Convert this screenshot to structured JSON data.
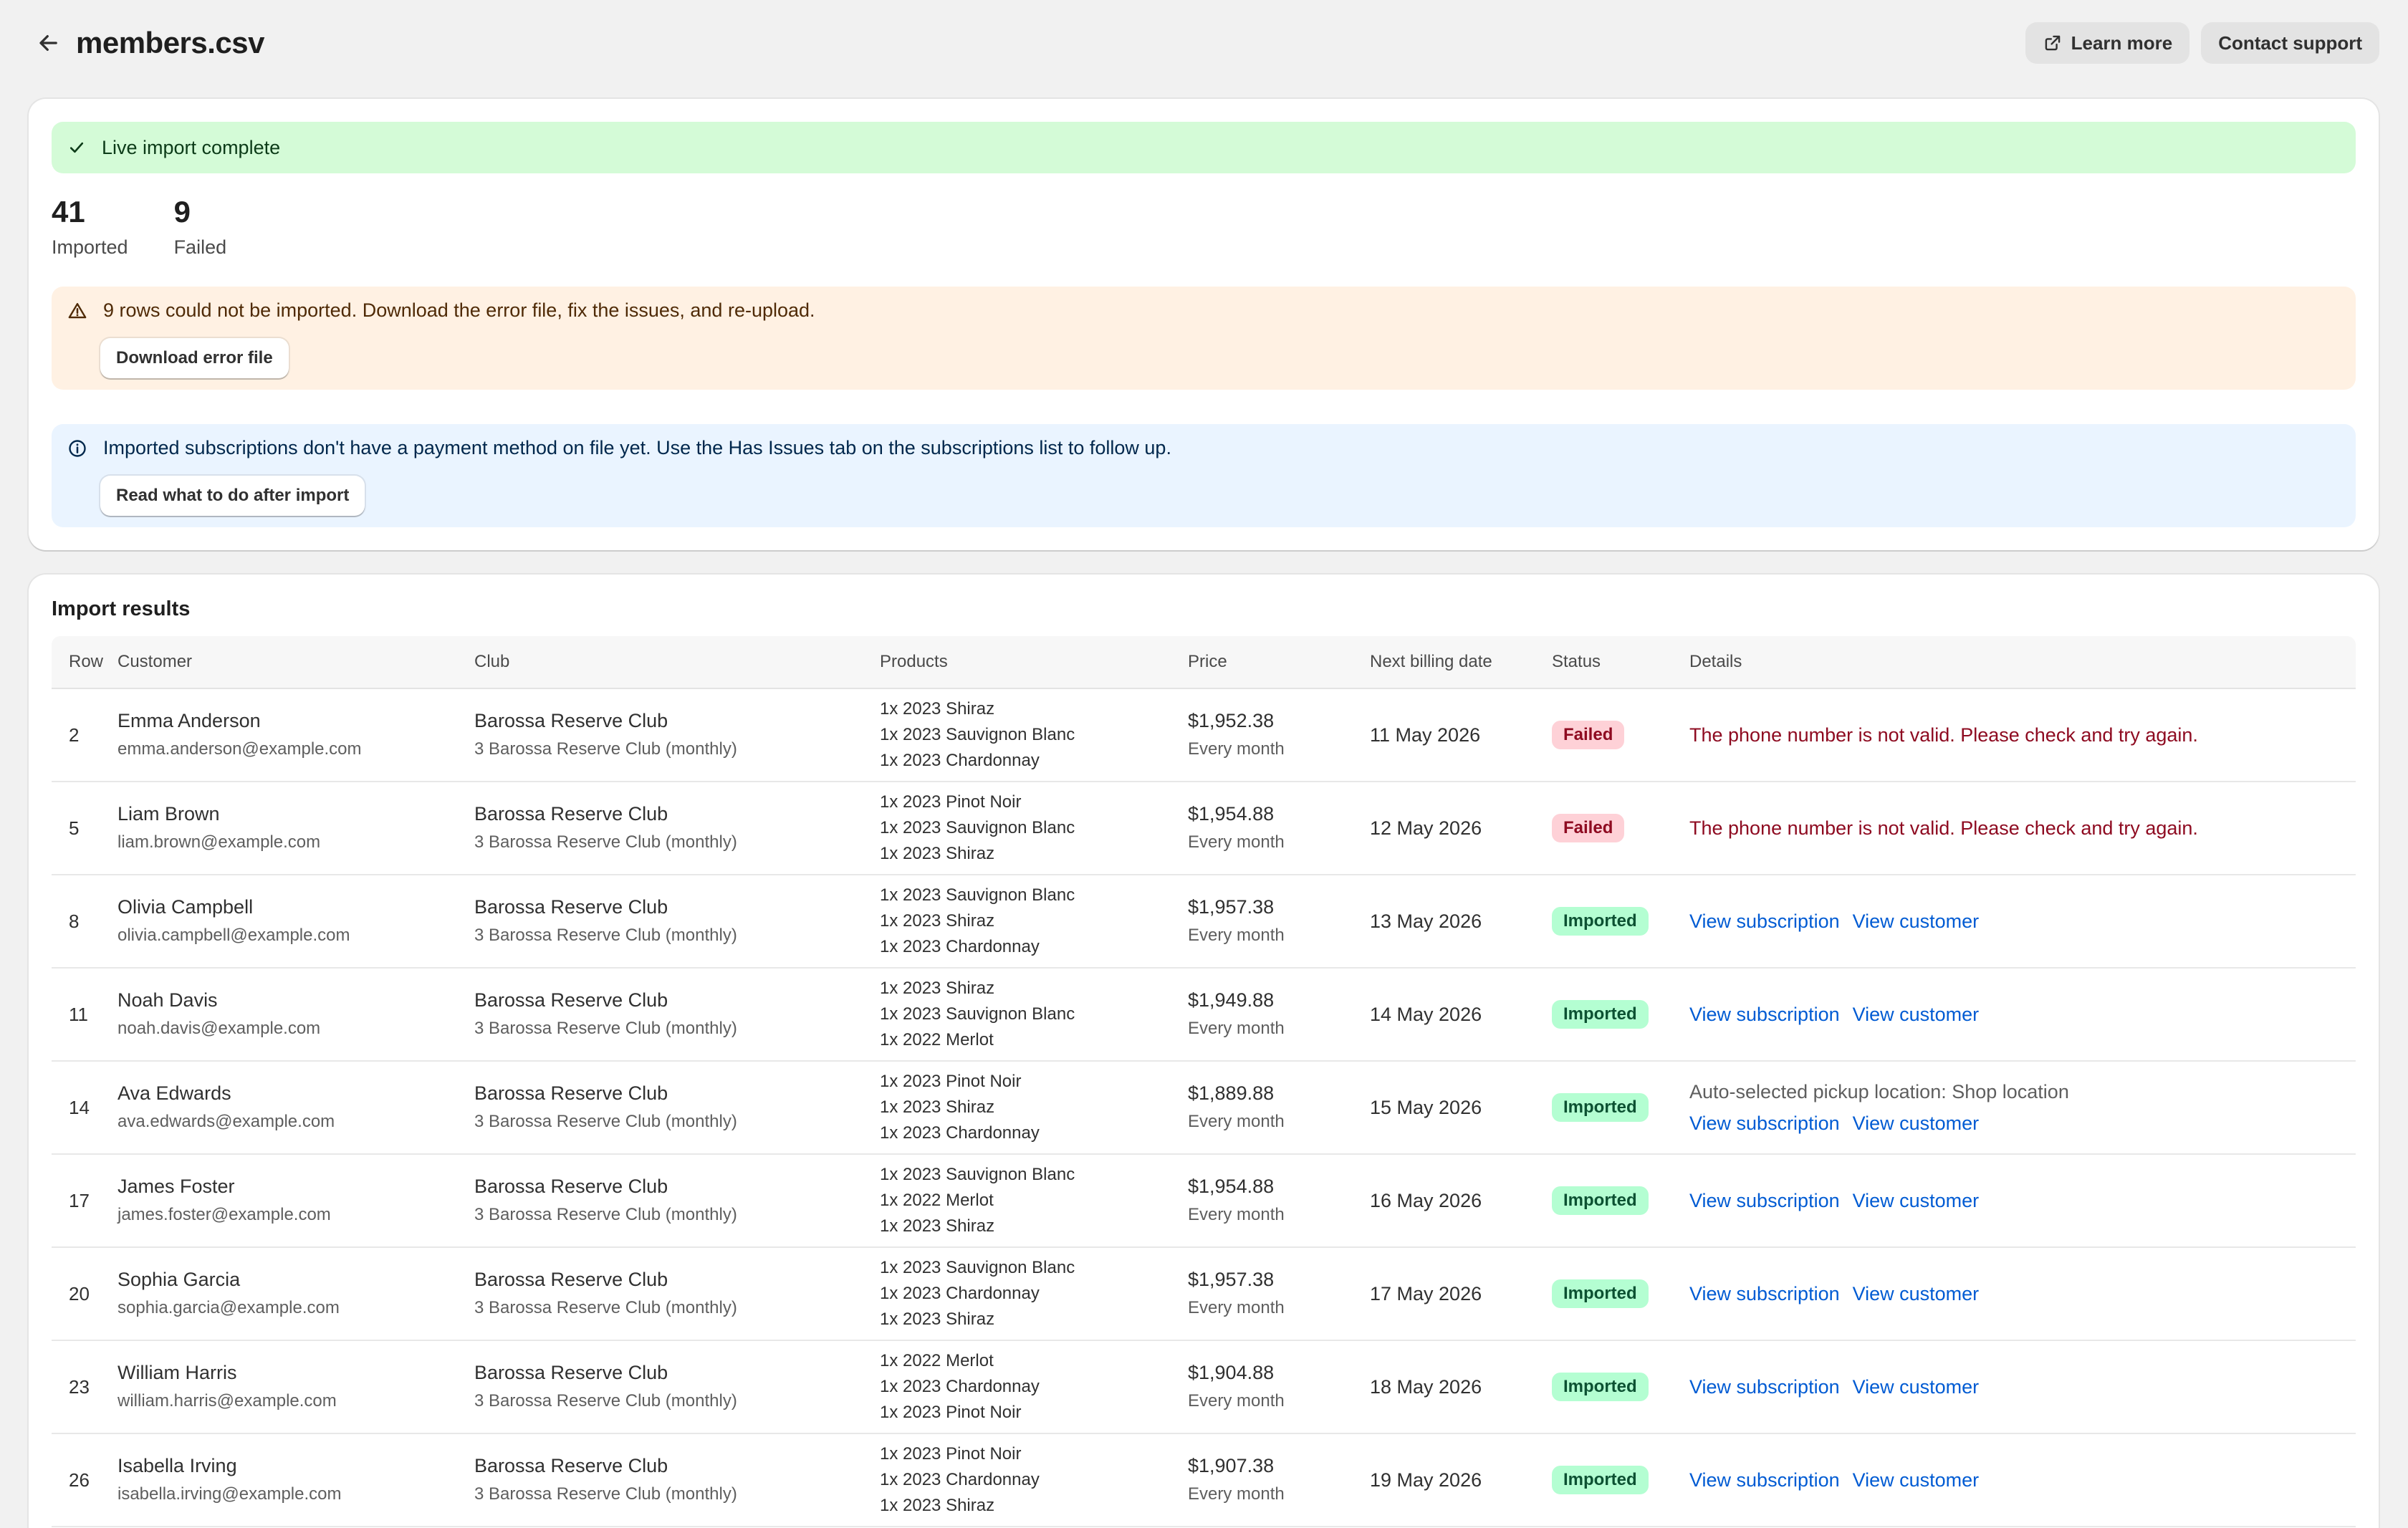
{
  "header": {
    "title": "members.csv",
    "learn_more": "Learn more",
    "contact_support": "Contact support"
  },
  "summary": {
    "success_banner": "Live import complete",
    "stats": [
      {
        "value": "41",
        "label": "Imported"
      },
      {
        "value": "9",
        "label": "Failed"
      }
    ],
    "warning": {
      "text": "9 rows could not be imported. Download the error file, fix the issues, and re-upload.",
      "button": "Download error file"
    },
    "info": {
      "text": "Imported subscriptions don't have a payment method on file yet. Use the Has Issues tab on the subscriptions list to follow up.",
      "button": "Read what to do after import"
    }
  },
  "results": {
    "title": "Import results",
    "columns": [
      "Row",
      "Customer",
      "Club",
      "Products",
      "Price",
      "Next billing date",
      "Status",
      "Details"
    ],
    "link_view_subscription": "View subscription",
    "link_view_customer": "View customer",
    "rows": [
      {
        "row": "2",
        "name": "Emma Anderson",
        "email": "emma.anderson@example.com",
        "club": "Barossa Reserve Club",
        "plan": "3 Barossa Reserve Club (monthly)",
        "products": [
          "1x 2023 Shiraz",
          "1x 2023 Sauvignon Blanc",
          "1x 2023 Chardonnay"
        ],
        "price": "$1,952.38",
        "frequency": "Every month",
        "date": "11 May 2026",
        "status": "Failed",
        "error": "The phone number is not valid. Please check and try again."
      },
      {
        "row": "5",
        "name": "Liam Brown",
        "email": "liam.brown@example.com",
        "club": "Barossa Reserve Club",
        "plan": "3 Barossa Reserve Club (monthly)",
        "products": [
          "1x 2023 Pinot Noir",
          "1x 2023 Sauvignon Blanc",
          "1x 2023 Shiraz"
        ],
        "price": "$1,954.88",
        "frequency": "Every month",
        "date": "12 May 2026",
        "status": "Failed",
        "error": "The phone number is not valid. Please check and try again."
      },
      {
        "row": "8",
        "name": "Olivia Campbell",
        "email": "olivia.campbell@example.com",
        "club": "Barossa Reserve Club",
        "plan": "3 Barossa Reserve Club (monthly)",
        "products": [
          "1x 2023 Sauvignon Blanc",
          "1x 2023 Shiraz",
          "1x 2023 Chardonnay"
        ],
        "price": "$1,957.38",
        "frequency": "Every month",
        "date": "13 May 2026",
        "status": "Imported"
      },
      {
        "row": "11",
        "name": "Noah Davis",
        "email": "noah.davis@example.com",
        "club": "Barossa Reserve Club",
        "plan": "3 Barossa Reserve Club (monthly)",
        "products": [
          "1x 2023 Shiraz",
          "1x 2023 Sauvignon Blanc",
          "1x 2022 Merlot"
        ],
        "price": "$1,949.88",
        "frequency": "Every month",
        "date": "14 May 2026",
        "status": "Imported"
      },
      {
        "row": "14",
        "name": "Ava Edwards",
        "email": "ava.edwards@example.com",
        "club": "Barossa Reserve Club",
        "plan": "3 Barossa Reserve Club (monthly)",
        "products": [
          "1x 2023 Pinot Noir",
          "1x 2023 Shiraz",
          "1x 2023 Chardonnay"
        ],
        "price": "$1,889.88",
        "frequency": "Every month",
        "date": "15 May 2026",
        "status": "Imported",
        "note": "Auto-selected pickup location: Shop location"
      },
      {
        "row": "17",
        "name": "James Foster",
        "email": "james.foster@example.com",
        "club": "Barossa Reserve Club",
        "plan": "3 Barossa Reserve Club (monthly)",
        "products": [
          "1x 2023 Sauvignon Blanc",
          "1x 2022 Merlot",
          "1x 2023 Shiraz"
        ],
        "price": "$1,954.88",
        "frequency": "Every month",
        "date": "16 May 2026",
        "status": "Imported"
      },
      {
        "row": "20",
        "name": "Sophia Garcia",
        "email": "sophia.garcia@example.com",
        "club": "Barossa Reserve Club",
        "plan": "3 Barossa Reserve Club (monthly)",
        "products": [
          "1x 2023 Sauvignon Blanc",
          "1x 2023 Chardonnay",
          "1x 2023 Shiraz"
        ],
        "price": "$1,957.38",
        "frequency": "Every month",
        "date": "17 May 2026",
        "status": "Imported"
      },
      {
        "row": "23",
        "name": "William Harris",
        "email": "william.harris@example.com",
        "club": "Barossa Reserve Club",
        "plan": "3 Barossa Reserve Club (monthly)",
        "products": [
          "1x 2022 Merlot",
          "1x 2023 Chardonnay",
          "1x 2023 Pinot Noir"
        ],
        "price": "$1,904.88",
        "frequency": "Every month",
        "date": "18 May 2026",
        "status": "Imported"
      },
      {
        "row": "26",
        "name": "Isabella Irving",
        "email": "isabella.irving@example.com",
        "club": "Barossa Reserve Club",
        "plan": "3 Barossa Reserve Club (monthly)",
        "products": [
          "1x 2023 Pinot Noir",
          "1x 2023 Chardonnay",
          "1x 2023 Shiraz"
        ],
        "price": "$1,907.38",
        "frequency": "Every month",
        "date": "19 May 2026",
        "status": "Imported"
      }
    ]
  },
  "icons": {
    "back": "arrow-left-icon",
    "external": "external-link-icon",
    "success": "checkmark-icon",
    "warning": "alert-triangle-icon",
    "info": "info-circle-icon"
  },
  "colors": {
    "success_bg": "#d4fbd7",
    "warning_bg": "#fff1e3",
    "info_bg": "#eaf4ff",
    "failed_badge": "#fed1d7",
    "imported_badge": "#b4fed2",
    "error_text": "#8e0b21",
    "link": "#005bd3"
  }
}
